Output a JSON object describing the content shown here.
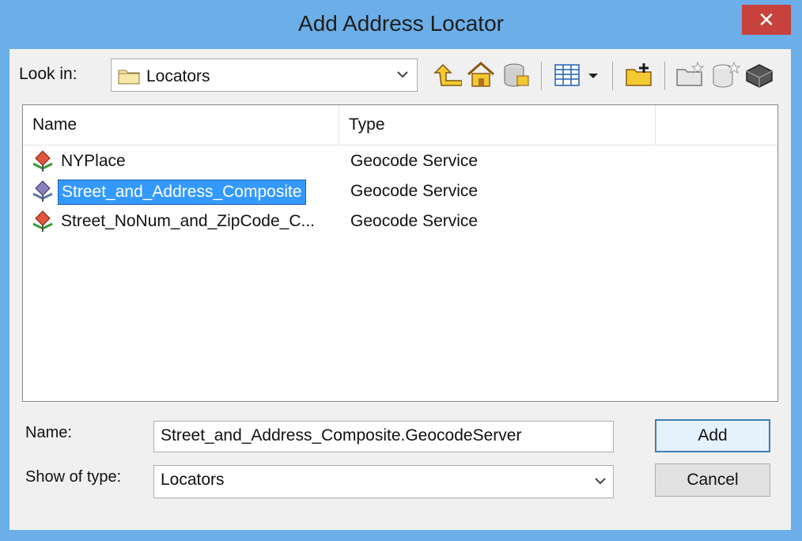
{
  "window": {
    "title": "Add Address Locator",
    "close_glyph": "✕"
  },
  "lookin": {
    "label": "Look in:",
    "value": "Locators",
    "folder_icon": "folder-icon"
  },
  "toolbar": {
    "icons": [
      "up-one-level-icon",
      "home-icon",
      "catalog-connections-icon",
      "view-details-icon",
      "view-options-dropdown-icon",
      "new-folder-icon",
      "new-item-icon",
      "new-database-icon",
      "toolbox-icon"
    ]
  },
  "list": {
    "columns": [
      "Name",
      "Type"
    ],
    "rows": [
      {
        "name": "NYPlace",
        "type": "Geocode Service",
        "selected": false
      },
      {
        "name": "Street_and_Address_Composite",
        "type": "Geocode Service",
        "selected": true
      },
      {
        "name": "Street_NoNum_and_ZipCode_C...",
        "type": "Geocode Service",
        "selected": false
      }
    ]
  },
  "form": {
    "name_label": "Name:",
    "name_value": "Street_and_Address_Composite.GeocodeServer",
    "type_label": "Show of type:",
    "type_value": "Locators",
    "add_label": "Add",
    "cancel_label": "Cancel"
  },
  "colors": {
    "titlebar": "#6caee8",
    "close": "#c7423d",
    "selection": "#3399ff"
  }
}
